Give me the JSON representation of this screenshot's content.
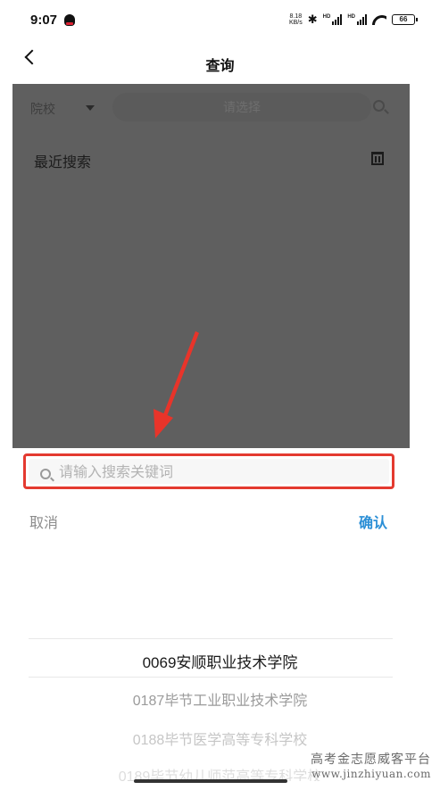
{
  "status_bar": {
    "time": "9:07",
    "net_speed_value": "8.18",
    "net_speed_unit": "KB/s",
    "signal_label": "HD",
    "battery": "66",
    "icons": [
      "qq-icon",
      "bluetooth-icon",
      "signal-icon",
      "wifi-icon",
      "battery-icon"
    ]
  },
  "header": {
    "title": "查询",
    "back_icon": "chevron-left-icon"
  },
  "filter": {
    "category_label": "院校",
    "select_placeholder": "请选择"
  },
  "recent": {
    "title": "最近搜索"
  },
  "picker": {
    "search_placeholder": "请输入搜索关键词",
    "cancel_label": "取消",
    "confirm_label": "确认",
    "items": [
      "0069安顺职业技术学院",
      "0187毕节工业职业技术学院",
      "0188毕节医学高等专科学校",
      "0189毕节幼儿师范高等专科学校"
    ],
    "selected_index": 0
  },
  "watermark": {
    "text_cn": "高考金志愿威客平台",
    "text_url": "www.jinzhiyuan.com"
  },
  "colors": {
    "overlay": "#5f5f5f",
    "highlight_border": "#e43a30",
    "confirm": "#2b8fd6"
  }
}
